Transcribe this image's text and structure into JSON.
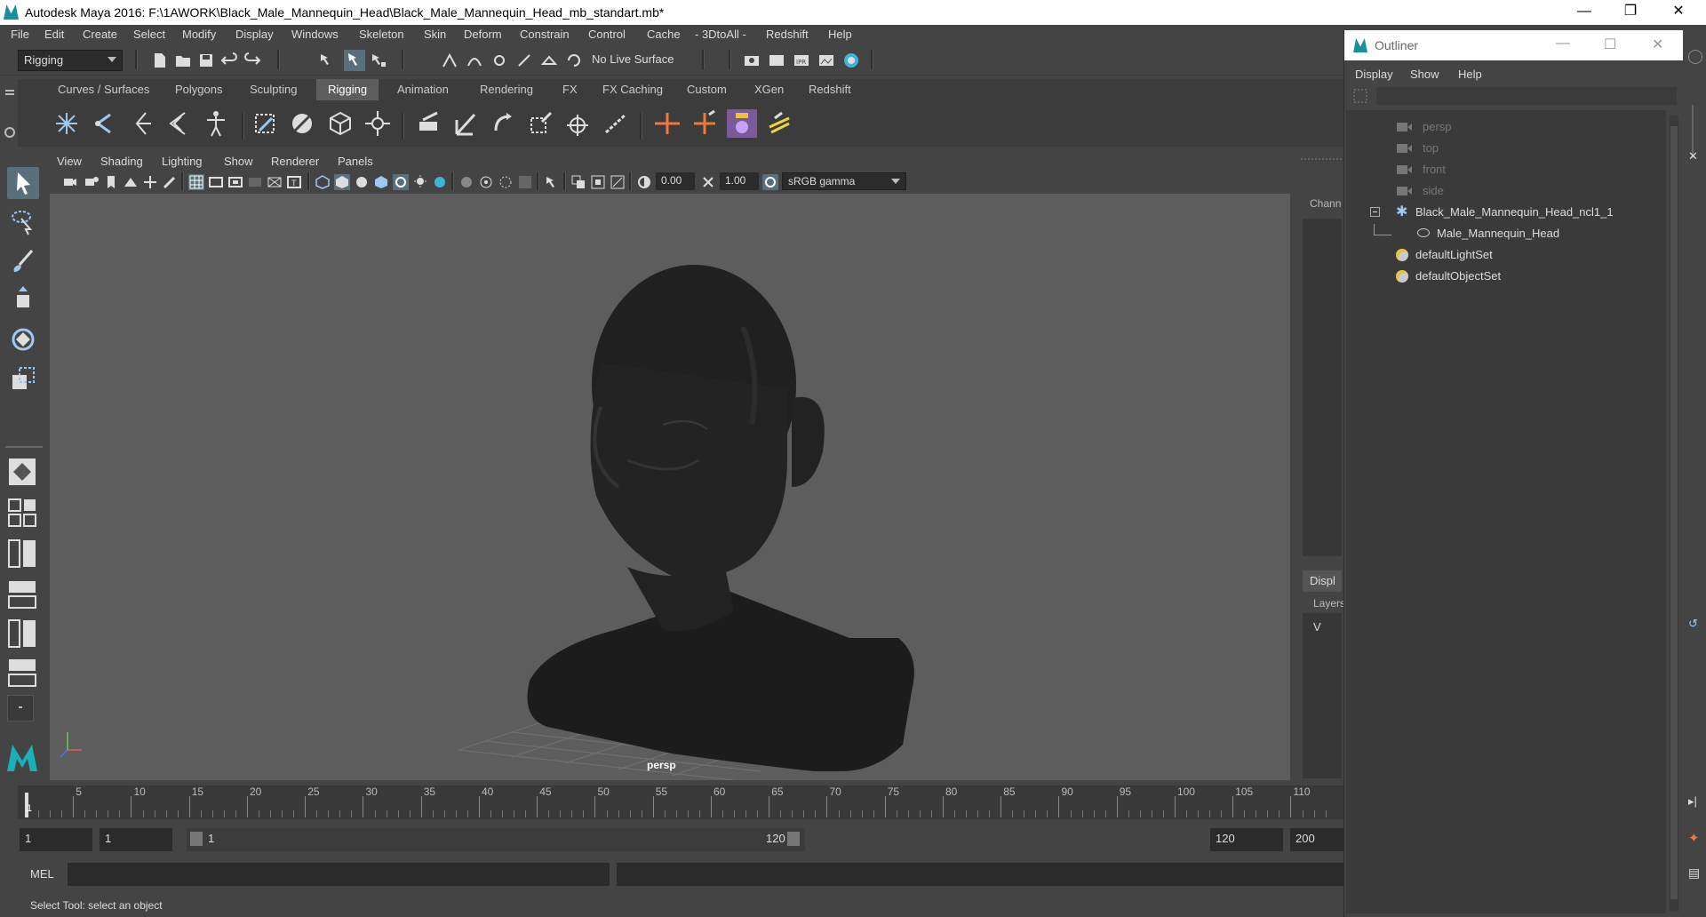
{
  "window": {
    "title": "Autodesk Maya 2016: F:\\1AWORK\\Black_Male_Mannequin_Head\\Black_Male_Mannequin_Head_mb_standart.mb*",
    "minimize": "—",
    "restore": "❐",
    "close": "✕"
  },
  "menubar": [
    "File",
    "Edit",
    "Create",
    "Select",
    "Modify",
    "Display",
    "Windows",
    "Skeleton",
    "Skin",
    "Deform",
    "Constrain",
    "Control",
    "Cache",
    "- 3DtoAll -",
    "Redshift",
    "Help"
  ],
  "statusline": {
    "menuset": "Rigging",
    "live_surface": "No Live Surface"
  },
  "shelf": {
    "tabs": [
      "Curves / Surfaces",
      "Polygons",
      "Sculpting",
      "Rigging",
      "Animation",
      "Rendering",
      "FX",
      "FX Caching",
      "Custom",
      "XGen",
      "Redshift"
    ],
    "active_tab": "Rigging"
  },
  "viewport": {
    "menus": [
      "View",
      "Shading",
      "Lighting",
      "Show",
      "Renderer",
      "Panels"
    ],
    "exposure": "0.00",
    "gamma": "1.00",
    "color_space": "sRGB gamma",
    "camera_label": "persp"
  },
  "channel": {
    "label": "Chann",
    "display_tab": "Displ",
    "layers_label": "Layers",
    "v_label": "V"
  },
  "timeline": {
    "labels": [
      "5",
      "10",
      "15",
      "20",
      "25",
      "30",
      "35",
      "40",
      "45",
      "50",
      "55",
      "60",
      "65",
      "70",
      "75",
      "80",
      "85",
      "90",
      "95",
      "100",
      "105",
      "110"
    ],
    "current_frame": "1"
  },
  "range": {
    "start": "1",
    "playback_start": "1",
    "slider_start": "1",
    "slider_end": "120",
    "playback_end": "120",
    "end": "200"
  },
  "cmdline": {
    "label": "MEL"
  },
  "helpline": {
    "text": "Select Tool: select an object"
  },
  "outliner": {
    "title": "Outliner",
    "menus": [
      "Display",
      "Show",
      "Help"
    ],
    "cameras": [
      "persp",
      "top",
      "front",
      "side"
    ],
    "group": "Black_Male_Mannequin_Head_ncl1_1",
    "mesh": "Male_Mannequin_Head",
    "sets": [
      "defaultLightSet",
      "defaultObjectSet"
    ]
  },
  "colors": {
    "accent": "#5a6f7c",
    "viewport_bg": "#5d5d5d",
    "panel_bg": "#444444",
    "maya_logo": "#1a8d9f"
  }
}
